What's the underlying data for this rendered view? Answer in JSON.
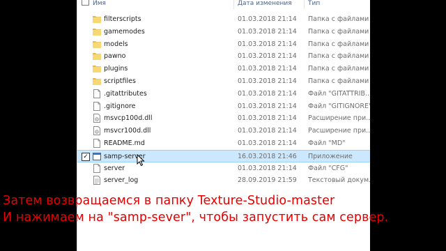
{
  "columns": {
    "name": "Имя",
    "date": "Дата изменения",
    "type": "Тип"
  },
  "files": [
    {
      "name": "filterscripts",
      "date": "01.03.2018 21:14",
      "type": "Папка с файлами",
      "icon": "folder-icon"
    },
    {
      "name": "gamemodes",
      "date": "01.03.2018 21:14",
      "type": "Папка с файлами",
      "icon": "folder-icon"
    },
    {
      "name": "models",
      "date": "01.03.2018 21:14",
      "type": "Папка с файлами",
      "icon": "folder-icon"
    },
    {
      "name": "pawno",
      "date": "01.03.2018 21:14",
      "type": "Папка с файлами",
      "icon": "folder-icon"
    },
    {
      "name": "plugins",
      "date": "01.03.2018 21:14",
      "type": "Папка с файлами",
      "icon": "folder-icon"
    },
    {
      "name": "scriptfiles",
      "date": "01.03.2018 21:14",
      "type": "Папка с файлами",
      "icon": "folder-icon"
    },
    {
      "name": ".gitattributes",
      "date": "01.03.2018 21:14",
      "type": "Файл \"GITATTRIB...",
      "icon": "file-icon"
    },
    {
      "name": ".gitignore",
      "date": "01.03.2018 21:14",
      "type": "Файл \"GITIGNORE\"",
      "icon": "file-icon"
    },
    {
      "name": "msvcp100d.dll",
      "date": "01.03.2018 21:14",
      "type": "Расширение при...",
      "icon": "dll-icon"
    },
    {
      "name": "msvcr100d.dll",
      "date": "01.03.2018 21:14",
      "type": "Расширение при...",
      "icon": "dll-icon"
    },
    {
      "name": "README.md",
      "date": "01.03.2018 21:14",
      "type": "Файл \"MD\"",
      "icon": "file-icon"
    },
    {
      "name": "samp-server",
      "date": "16.03.2018 21:46",
      "type": "Приложение",
      "icon": "application-icon",
      "selected": true
    },
    {
      "name": "server",
      "date": "01.03.2018 21:14",
      "type": "Файл \"CFG\"",
      "icon": "file-icon"
    },
    {
      "name": "server_log",
      "date": "28.09.2019 21:59",
      "type": "Текстовый докум...",
      "icon": "text-file-icon"
    }
  ],
  "caption": {
    "line1": "Затем возвращаемся в папку Texture-Studio-master",
    "line2": "И нажимаем на \"samp-sever\", чтобы запустить сам сервер."
  },
  "colors": {
    "selection": "#cce8ff",
    "caption": "#e60000",
    "folder": "#f8d775"
  }
}
